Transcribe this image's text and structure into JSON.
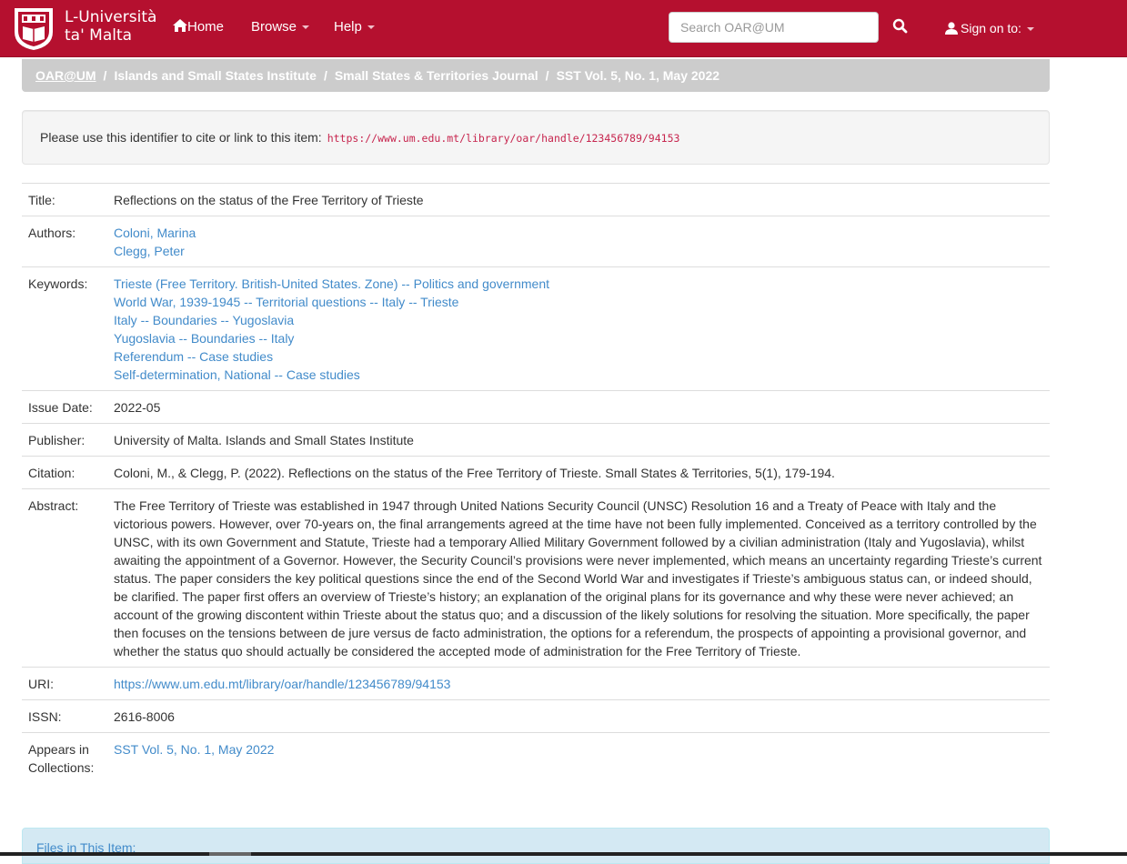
{
  "brand": {
    "line1": "L-Università",
    "line2": "ta' Malta"
  },
  "nav": {
    "home": "Home",
    "browse": "Browse",
    "help": "Help",
    "search_placeholder": "Search OAR@UM",
    "signon": "Sign on to:"
  },
  "breadcrumb": [
    "OAR@UM",
    "Islands and Small States Institute",
    "Small States & Territories Journal",
    "SST Vol. 5, No. 1, May 2022"
  ],
  "cite": {
    "label": "Please use this identifier to cite or link to this item:",
    "url": "https://www.um.edu.mt/library/oar/handle/123456789/94153"
  },
  "metadata": {
    "title_label": "Title:",
    "title": "Reflections on the status of the Free Territory of Trieste",
    "authors_label": "Authors:",
    "authors": [
      "Coloni, Marina",
      "Clegg, Peter"
    ],
    "keywords_label": "Keywords:",
    "keywords": [
      "Trieste (Free Territory. British-United States. Zone) -- Politics and government",
      "World War, 1939-1945 -- Territorial questions -- Italy -- Trieste",
      "Italy -- Boundaries -- Yugoslavia",
      "Yugoslavia -- Boundaries -- Italy",
      "Referendum -- Case studies",
      "Self-determination, National -- Case studies"
    ],
    "issue_date_label": "Issue Date:",
    "issue_date": "2022-05",
    "publisher_label": "Publisher:",
    "publisher": "University of Malta. Islands and Small States Institute",
    "citation_label": "Citation:",
    "citation": "Coloni, M., & Clegg, P. (2022). Reflections on the status of the Free Territory of Trieste. Small States & Territories, 5(1), 179-194.",
    "abstract_label": "Abstract:",
    "abstract": "The Free Territory of Trieste was established in 1947 through United Nations Security Council (UNSC) Resolution 16 and a Treaty of Peace with Italy and the victorious powers. However, over 70-years on, the final arrangements agreed at the time have not been fully implemented. Conceived as a territory controlled by the UNSC, with its own Government and Statute, Trieste had a temporary Allied Military Government followed by a civilian administration (Italy and Yugoslavia), whilst awaiting the appointment of a Governor. However, the Security Council’s provisions were never implemented, which means an uncertainty regarding Trieste’s current status. The paper considers the key political questions since the end of the Second World War and investigates if Trieste’s ambiguous status can, or indeed should, be clarified. The paper first offers an overview of Trieste’s history; an explanation of the original plans for its governance and why these were never achieved; an account of the growing discontent within Trieste about the status quo; and a discussion of the likely solutions for resolving the situation. More specifically, the paper then focuses on the tensions between de jure versus de facto administration, the options for a referendum, the prospects of appointing a provisional governor, and whether the status quo should actually be considered the accepted mode of administration for the Free Territory of Trieste.",
    "uri_label": "URI:",
    "uri": "https://www.um.edu.mt/library/oar/handle/123456789/94153",
    "issn_label": "ISSN:",
    "issn": "2616-8006",
    "collections_label": "Appears in Collections:",
    "collection": "SST Vol. 5, No. 1, May 2022"
  },
  "files": {
    "heading": "Files in This Item:"
  }
}
